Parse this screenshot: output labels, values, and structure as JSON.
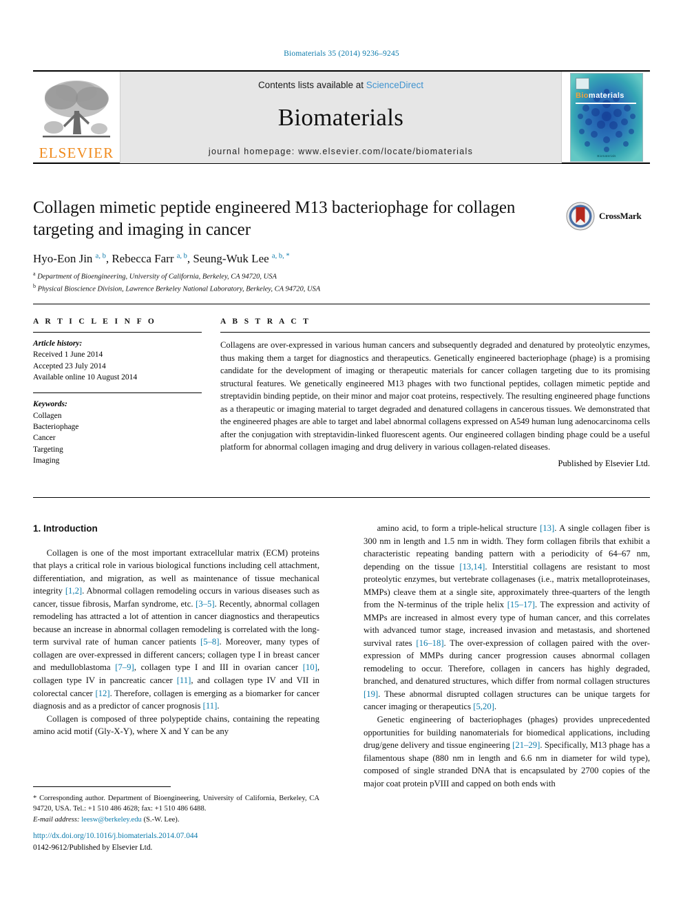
{
  "running_head": "Biomaterials 35 (2014) 9236–9245",
  "masthead": {
    "publisher_wordmark": "ELSEVIER",
    "contents_prefix": "Contents lists available at ",
    "contents_link": "ScienceDirect",
    "journal_name": "Biomaterials",
    "homepage": "journal homepage: www.elsevier.com/locate/biomaterials",
    "cover": {
      "title_first": "Bio",
      "title_rest": "materials",
      "footer": "Biomaterials"
    }
  },
  "article": {
    "title": "Collagen mimetic peptide engineered M13 bacteriophage for collagen targeting and imaging in cancer",
    "authors_html": "Hyo-Eon Jin <sup>a, b</sup>, Rebecca Farr <sup>a, b</sup>, Seung-Wuk Lee <sup>a, b, *</sup>",
    "affiliation_a": "Department of Bioengineering, University of California, Berkeley, CA 94720, USA",
    "affiliation_b": "Physical Bioscience Division, Lawrence Berkeley National Laboratory, Berkeley, CA 94720, USA",
    "crossmark_label": "CrossMark"
  },
  "info": {
    "heading": "A R T I C L E   I N F O",
    "history_label": "Article history:",
    "history": [
      "Received 1 June 2014",
      "Accepted 23 July 2014",
      "Available online 10 August 2014"
    ],
    "keywords_label": "Keywords:",
    "keywords": [
      "Collagen",
      "Bacteriophage",
      "Cancer",
      "Targeting",
      "Imaging"
    ]
  },
  "abstract": {
    "heading": "A B S T R A C T",
    "text": "Collagens are over-expressed in various human cancers and subsequently degraded and denatured by proteolytic enzymes, thus making them a target for diagnostics and therapeutics. Genetically engineered bacteriophage (phage) is a promising candidate for the development of imaging or therapeutic materials for cancer collagen targeting due to its promising structural features. We genetically engineered M13 phages with two functional peptides, collagen mimetic peptide and streptavidin binding peptide, on their minor and major coat proteins, respectively. The resulting engineered phage functions as a therapeutic or imaging material to target degraded and denatured collagens in cancerous tissues. We demonstrated that the engineered phages are able to target and label abnormal collagens expressed on A549 human lung adenocarcinoma cells after the conjugation with streptavidin-linked fluorescent agents. Our engineered collagen binding phage could be a useful platform for abnormal collagen imaging and drug delivery in various collagen-related diseases.",
    "publisher_note": "Published by Elsevier Ltd."
  },
  "body": {
    "section_heading": "1. Introduction",
    "left_paragraph_1": "Collagen is one of the most important extracellular matrix (ECM) proteins that plays a critical role in various biological functions including cell attachment, differentiation, and migration, as well as maintenance of tissue mechanical integrity [1,2]. Abnormal collagen remodeling occurs in various diseases such as cancer, tissue fibrosis, Marfan syndrome, etc. [3–5]. Recently, abnormal collagen remodeling has attracted a lot of attention in cancer diagnostics and therapeutics because an increase in abnormal collagen remodeling is correlated with the long-term survival rate of human cancer patients [5–8]. Moreover, many types of collagen are over-expressed in different cancers; collagen type I in breast cancer and medulloblastoma [7–9], collagen type I and III in ovarian cancer [10], collagen type IV in pancreatic cancer [11], and collagen type IV and VII in colorectal cancer [12]. Therefore, collagen is emerging as a biomarker for cancer diagnosis and as a predictor of cancer prognosis [11].",
    "left_paragraph_2": "Collagen is composed of three polypeptide chains, containing the repeating amino acid motif (Gly-X-Y), where X and Y can be any",
    "right_paragraph_1": "amino acid, to form a triple-helical structure [13]. A single collagen fiber is 300 nm in length and 1.5 nm in width. They form collagen fibrils that exhibit a characteristic repeating banding pattern with a periodicity of 64–67 nm, depending on the tissue [13,14]. Interstitial collagens are resistant to most proteolytic enzymes, but vertebrate collagenases (i.e., matrix metalloproteinases, MMPs) cleave them at a single site, approximately three-quarters of the length from the N-terminus of the triple helix [15–17]. The expression and activity of MMPs are increased in almost every type of human cancer, and this correlates with advanced tumor stage, increased invasion and metastasis, and shortened survival rates [16–18]. The over-expression of collagen paired with the over-expression of MMPs during cancer progression causes abnormal collagen remodeling to occur. Therefore, collagen in cancers has highly degraded, branched, and denatured structures, which differ from normal collagen structures [19]. These abnormal disrupted collagen structures can be unique targets for cancer imaging or therapeutics [5,20].",
    "right_paragraph_2": "Genetic engineering of bacteriophages (phages) provides unprecedented opportunities for building nanomaterials for biomedical applications, including drug/gene delivery and tissue engineering [21–29]. Specifically, M13 phage has a filamentous shape (880 nm in length and 6.6 nm in diameter for wild type), composed of single stranded DNA that is encapsulated by 2700 copies of the major coat protein pVIII and capped on both ends with"
  },
  "footnote": {
    "corresponding": "* Corresponding author. Department of Bioengineering, University of California, Berkeley, CA 94720, USA. Tel.: +1 510 486 4628; fax: +1 510 486 6488.",
    "email_label": "E-mail address:",
    "email": "leesw@berkeley.edu",
    "email_suffix": "(S.-W. Lee)."
  },
  "footer": {
    "doi": "http://dx.doi.org/10.1016/j.biomaterials.2014.07.044",
    "issn_line": "0142-9612/Published by Elsevier Ltd."
  },
  "colors": {
    "link": "#0b7aab",
    "sciencedirect": "#3f93cf",
    "elsevier_orange": "#f08a1c",
    "cover_teal": "#2e9fb0"
  }
}
